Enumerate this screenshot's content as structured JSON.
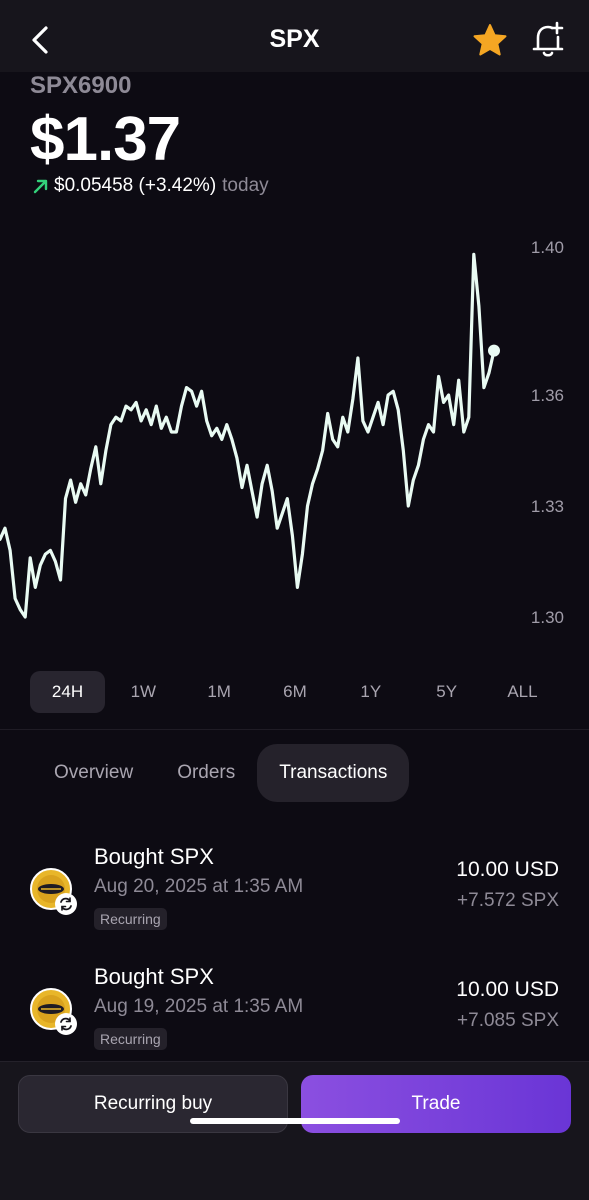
{
  "header": {
    "title": "SPX",
    "icons": {
      "back": "chevron-left-icon",
      "favorite": "star-icon",
      "alert": "bell-plus-icon"
    }
  },
  "asset": {
    "ticker": "SPX6900",
    "price": "$1.37",
    "change": "$0.05458 (+3.42%)",
    "change_period": "today",
    "change_icon": "arrow-up-right-icon"
  },
  "colors": {
    "background": "#0d0b13",
    "line": "#e9fbf3",
    "positive": "#33d17a",
    "star": "#f5a623",
    "trade_button": "#7a42db"
  },
  "chart_data": {
    "type": "line",
    "y_ticks": [
      "1.40",
      "1.36",
      "1.33",
      "1.30"
    ],
    "ylim": [
      1.3,
      1.4
    ],
    "grid": false,
    "series": [
      {
        "values": [
          1.321,
          1.324,
          1.318,
          1.305,
          1.302,
          1.3,
          1.316,
          1.308,
          1.314,
          1.317,
          1.318,
          1.315,
          1.31,
          1.332,
          1.337,
          1.331,
          1.336,
          1.333,
          1.34,
          1.346,
          1.336,
          1.345,
          1.352,
          1.354,
          1.353,
          1.357,
          1.356,
          1.358,
          1.353,
          1.356,
          1.352,
          1.357,
          1.351,
          1.354,
          1.35,
          1.35,
          1.357,
          1.362,
          1.361,
          1.357,
          1.361,
          1.353,
          1.349,
          1.351,
          1.348,
          1.352,
          1.348,
          1.343,
          1.335,
          1.341,
          1.334,
          1.327,
          1.336,
          1.341,
          1.334,
          1.324,
          1.328,
          1.332,
          1.322,
          1.308,
          1.317,
          1.33,
          1.336,
          1.34,
          1.345,
          1.355,
          1.348,
          1.346,
          1.354,
          1.35,
          1.359,
          1.37,
          1.353,
          1.35,
          1.354,
          1.358,
          1.352,
          1.36,
          1.361,
          1.356,
          1.345,
          1.33,
          1.337,
          1.341,
          1.348,
          1.352,
          1.35,
          1.365,
          1.358,
          1.36,
          1.352,
          1.364,
          1.35,
          1.354,
          1.398,
          1.384,
          1.362,
          1.366,
          1.372
        ]
      }
    ]
  },
  "time_ranges": [
    "24H",
    "1W",
    "1M",
    "6M",
    "1Y",
    "5Y",
    "ALL"
  ],
  "active_range": "24H",
  "tabs": [
    "Overview",
    "Orders",
    "Transactions"
  ],
  "active_tab": "Transactions",
  "transactions": [
    {
      "title": "Bought SPX",
      "date": "Aug 20, 2025 at 1:35 AM",
      "badge": "Recurring",
      "amount": "10.00 USD",
      "quantity": "+7.572 SPX",
      "icon": "spx-coin-icon"
    },
    {
      "title": "Bought SPX",
      "date": "Aug 19, 2025 at 1:35 AM",
      "badge": "Recurring",
      "amount": "10.00 USD",
      "quantity": "+7.085 SPX",
      "icon": "spx-coin-icon"
    }
  ],
  "actions": {
    "recurring_buy": "Recurring buy",
    "trade": "Trade"
  }
}
